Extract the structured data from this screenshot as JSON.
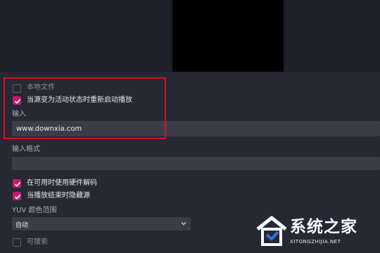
{
  "settings": {
    "local_file_label": "本地文件",
    "restart_label": "当源变为活动状态时重新启动播放",
    "input_label": "输入",
    "input_value": "www.downxia.com",
    "input_format_label": "输入格式",
    "input_format_value": "",
    "hw_decode_label": "在可用时使用硬件解码",
    "hide_source_label": "当播放结束时隐藏源",
    "yuv_range_label": "YUV 颜色范围",
    "yuv_range_value": "自动",
    "searchable_label": "可搜索"
  },
  "watermark": {
    "title": "系统之家",
    "site": "XITONGZHIJIA.NET"
  },
  "colors": {
    "checkbox_checked": "#c31c73",
    "highlight_border": "#d4131b",
    "background": "#262833"
  }
}
